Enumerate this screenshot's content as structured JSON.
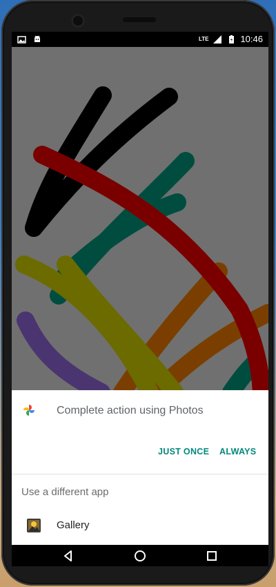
{
  "statusbar": {
    "left_icons": [
      "gallery-notification-icon",
      "android-icon"
    ],
    "network": "LTE",
    "time": "10:46"
  },
  "canvas": {
    "background": "#707070",
    "strokes": [
      {
        "color": "#000000"
      },
      {
        "color": "#000000"
      },
      {
        "color": "#004d40"
      },
      {
        "color": "#004d40"
      },
      {
        "color": "#7a0000"
      },
      {
        "color": "#6b6b00"
      },
      {
        "color": "#6b6b00"
      },
      {
        "color": "#7a3f00"
      },
      {
        "color": "#7a3f00"
      },
      {
        "color": "#4a3570"
      }
    ]
  },
  "chooser": {
    "title": "Complete action using Photos",
    "just_once_label": "JUST ONCE",
    "always_label": "ALWAYS",
    "different_app_label": "Use a different app",
    "apps": [
      {
        "label": "Gallery",
        "icon": "gallery-icon"
      }
    ],
    "accent": "#00897b"
  },
  "navbar": {
    "buttons": [
      "back-icon",
      "home-icon",
      "recents-icon"
    ]
  }
}
